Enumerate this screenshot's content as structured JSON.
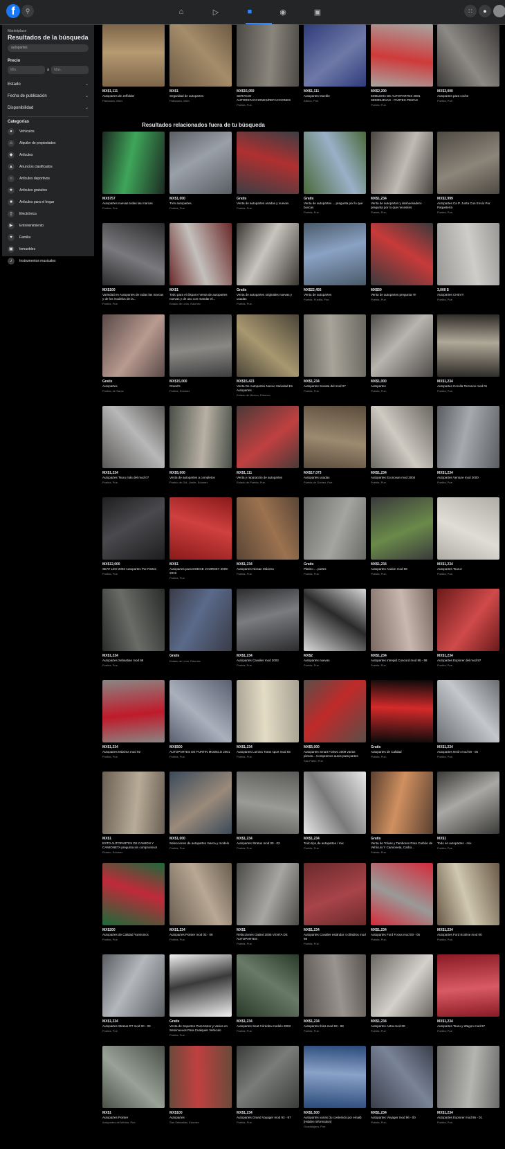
{
  "sidebar": {
    "breadcrumb": "Marketplace",
    "title": "Resultados de la búsqueda",
    "search_value": "autopartes",
    "price_label": "Precio",
    "min_placeholder": "Mín.",
    "max_placeholder": "Máx.",
    "price_separator": "a",
    "filters": [
      "Estado",
      "Fecha de publicación",
      "Disponibilidad"
    ],
    "categories_label": "Categorías",
    "categories": [
      {
        "label": "Vehículos",
        "icon": "car-icon"
      },
      {
        "label": "Alquiler de propiedades",
        "icon": "house-icon"
      },
      {
        "label": "Artículos",
        "icon": "tag-icon"
      },
      {
        "label": "Anuncios clasificados",
        "icon": "megaphone-icon"
      },
      {
        "label": "Artículos deportivos",
        "icon": "sports-icon"
      },
      {
        "label": "Artículos gratuitos",
        "icon": "free-icon"
      },
      {
        "label": "Artículos para el hogar",
        "icon": "sofa-icon"
      },
      {
        "label": "Electrónica",
        "icon": "phone-icon"
      },
      {
        "label": "Entretenimiento",
        "icon": "film-icon"
      },
      {
        "label": "Familia",
        "icon": "heart-icon"
      },
      {
        "label": "Inmuebles",
        "icon": "building-icon"
      },
      {
        "label": "Instrumentos musicales",
        "icon": "guitar-icon"
      }
    ]
  },
  "related_heading": "Resultados relacionados fuera de tu búsqueda",
  "listings": [
    {
      "price": "MX$1,111",
      "title": "Autopartes de Jeffolder",
      "loc": "Pátzcuaro, Mich."
    },
    {
      "price": "MX$1",
      "title": "Seguridad de autopartes",
      "loc": "Pátzcuaro, Mich."
    },
    {
      "price": "MX$15,059",
      "title": "SERVICIO AUTOREFACCIONES/REFACCIONES PARA TODO TIPO PIEZAS DE COLISION",
      "loc": "Puebla, Pue."
    },
    {
      "price": "MX$1,111",
      "title": "Autopartes Mueble",
      "loc": "Atlixco, Pue."
    },
    {
      "price": "MX$2,200",
      "title": "EMBLEMA DE AUTOPARTES 2001 SEMINUEVAS - PARTES PIEZAS DEPORTIVAS...",
      "loc": "Puebla, Pue."
    },
    {
      "price": "MX$3,000",
      "title": "Autopartes para coche",
      "loc": "Puebla, Pue."
    },
    {
      "price": "MX$757",
      "title": "Autopartes nuevas todas las marcas",
      "loc": "Puebla, Pue."
    },
    {
      "price": "MX$1,000",
      "title": "Tren autopartes",
      "loc": "Puebla, Pue."
    },
    {
      "price": "Gratis",
      "title": "Venta de autopartes usadas y nuevas",
      "loc": "Puebla, Pue."
    },
    {
      "price": "Gratis",
      "title": "Venta de autopartes ... pregunta por lo que buscas",
      "loc": "Puebla, Pue."
    },
    {
      "price": "MX$1,234",
      "title": "Venta de autopartes y deshuesadero pregunta por lo que necesites",
      "loc": "Puebla, Pue."
    },
    {
      "price": "MX$2,999",
      "title": "Autopartes Ca P. Junta Con Envío Por Paquetería",
      "loc": "Puebla, Pue."
    },
    {
      "price": "MX$100",
      "title": "Variedad en Autopartes de todas las marcas y de los modelos de la...",
      "loc": "Puebla, Pue."
    },
    {
      "price": "MX$1",
      "title": "Todo para el disparo! Venta de autopartes nuevas y de uso con mandar el...",
      "loc": "Estado de León, Edomex"
    },
    {
      "price": "Gratis",
      "title": "Venta de autopartes originales nuevas y usadas",
      "loc": "Puebla, Pue."
    },
    {
      "price": "MX$22,456",
      "title": "Venta de autopartes",
      "loc": "Puebla, Puebla, Pue."
    },
    {
      "price": "MX$50",
      "title": "Venta de autopartes pregunta !!!!",
      "loc": "Puebla, Pue."
    },
    {
      "price": "3,000 $",
      "title": "Autopartes CHEVY",
      "loc": "Puebla, Pue."
    },
    {
      "price": "Gratis",
      "title": "Autopartes",
      "loc": "Puebla, de Saraz"
    },
    {
      "price": "MX$15,000",
      "title": "Grand's",
      "loc": "Puebla, Edomex"
    },
    {
      "price": "MX$15,423",
      "title": "Venta De Autopartes Nuevo Variedad En Autopartes",
      "loc": "Estado de México, Edomex"
    },
    {
      "price": "MX$1,234",
      "title": "Autopartes Sonata del mod 07",
      "loc": "Puebla, Pue."
    },
    {
      "price": "MX$1,000",
      "title": "Autopartes",
      "loc": "Puebla, Pue."
    },
    {
      "price": "MX$1,234",
      "title": "Autopartes Corolla Terranos mod 01",
      "loc": "Puebla, Pue."
    },
    {
      "price": "MX$1,234",
      "title": "Autopartes Tsuru más del mod 07",
      "loc": "Puebla, Pue."
    },
    {
      "price": "MX$5,000",
      "title": "Venta de autopartes a completos",
      "loc": "Pueblo de Gdl. Límite, Edomex"
    },
    {
      "price": "MX$1,111",
      "title": "Venta y reparación de autopartes",
      "loc": "Estado de Puebla, Pue."
    },
    {
      "price": "MX$17,073",
      "title": "Autopartes usadas",
      "loc": "Puebla de Gómez, Pue."
    },
    {
      "price": "MX$1,234",
      "title": "Autopartes Econovan mod 2004",
      "loc": "Puebla, Pue."
    },
    {
      "price": "MX$1,234",
      "title": "Autopartes Venture mod 2000",
      "loc": "Puebla, Pue."
    },
    {
      "price": "MX$12,000",
      "title": "SEAT LEO 2003 Autopartes Por Partes",
      "loc": "Puebla, Pue."
    },
    {
      "price": "MX$1",
      "title": "Autopartes para DODGE JOURNEY 2009-2019",
      "loc": "Puebla, Pue."
    },
    {
      "price": "MX$1,234",
      "title": "Autopartes Nissan Máxima",
      "loc": "Puebla, Pue."
    },
    {
      "price": "Gratis",
      "title": "Platino ... partes",
      "loc": "Puebla, Pue."
    },
    {
      "price": "MX$1,234",
      "title": "Autopartes Avalon mod 98",
      "loc": "Puebla, Pue."
    },
    {
      "price": "MX$1,234",
      "title": "Autopartes Tsuru I",
      "loc": "Puebla, Pue."
    },
    {
      "price": "MX$1,234",
      "title": "Autopartes Sebastian mod 98",
      "loc": "Puebla, Pue."
    },
    {
      "price": "Gratis",
      "title": "",
      "loc": "Estado de León, Edomex"
    },
    {
      "price": "MX$1,234",
      "title": "Autopartes Cavalier mod 2003",
      "loc": "Puebla, Pue."
    },
    {
      "price": "MX$2",
      "title": "Autopartes nuevas",
      "loc": "Puebla, Pue."
    },
    {
      "price": "MX$1,234",
      "title": "Autopartes Intrepid Concord mod 95 - 98",
      "loc": "Puebla, Pue."
    },
    {
      "price": "MX$1,234",
      "title": "Autopartes Explorer del mod 97",
      "loc": "Puebla, Pue."
    },
    {
      "price": "MX$1,234",
      "title": "Autopartes Máxima mod 92",
      "loc": "Puebla, Pue."
    },
    {
      "price": "MX$500",
      "title": "AUTOPARTES DE PURTIN MODELO 2001",
      "loc": "Puebla, Pue."
    },
    {
      "price": "MX$1,234",
      "title": "Autopartes Lumina Trans sport mod 93",
      "loc": "Puebla, Pue."
    },
    {
      "price": "MX$5,000",
      "title": "Autopartes Smart Fortwo 2009 varias piezas... Compramos autos para partes",
      "loc": "San Pablo, Pue."
    },
    {
      "price": "Gratis",
      "title": "Autopartes de Calidad",
      "loc": "Puebla, Pue."
    },
    {
      "price": "MX$1,234",
      "title": "Autopartes Neón mod 00 - 05",
      "loc": "Puebla, Pue."
    },
    {
      "price": "MX$1",
      "title": "ESTO AUTOPARTES DE CAMION Y CAMIONETA pregunta sin compromiso!",
      "loc": "Estado, Edomex"
    },
    {
      "price": "MX$1,000",
      "title": "Selecciones de autopartes marca y modelo",
      "loc": "Puebla, Pue."
    },
    {
      "price": "MX$1,234",
      "title": "Autopartes Stratus mod 00 - 03",
      "loc": "Puebla, Pue."
    },
    {
      "price": "MX$1,234",
      "title": "Todo tipo de autopartes / mix",
      "loc": "Puebla, Pue."
    },
    {
      "price": "Gratis",
      "title": "Venta de Tolvas y Tambores Para Carbón de Vehículo Y Camioneta, Carbo...",
      "loc": "Puebla, Pue."
    },
    {
      "price": "MX$1",
      "title": "Todo en autopartes - mix",
      "loc": "Puebla, Pue."
    },
    {
      "price": "MX$200",
      "title": "Autopartes de Calidad Yuntronics",
      "loc": "Puebla, Pue."
    },
    {
      "price": "MX$1,234",
      "title": "Autopartes Pointer mod 03 - 09",
      "loc": "Puebla, Pue."
    },
    {
      "price": "MX$1",
      "title": "Refacciones Galant 2005 VENTA DE AUTOPARTES",
      "loc": "Puebla, Pue."
    },
    {
      "price": "MX$1,234",
      "title": "Autopartes Cavalier estándar 4 cilindros mod 98",
      "loc": "Puebla, Pue."
    },
    {
      "price": "MX$1,234",
      "title": "Autopartes Ford Focus mod 00 - 05",
      "loc": "Puebla, Pue."
    },
    {
      "price": "MX$1,234",
      "title": "Autopartes Ford Ecoline mod 00",
      "loc": "Puebla, Pue."
    },
    {
      "price": "MX$1,234",
      "title": "Autopartes Stratus RT mod 00 - 03",
      "loc": "Puebla, Pue."
    },
    {
      "price": "Gratis",
      "title": "Venta de Soportes Para Motor y Varios en Seminuevos Para Cualquier Vehículo",
      "loc": "Puebla, Pue."
    },
    {
      "price": "MX$1,234",
      "title": "Autopartes Seat Córdoba modelo 2003",
      "loc": "Puebla, Pue."
    },
    {
      "price": "MX$1,234",
      "title": "Autopartes Ibiza mod 93 - 98",
      "loc": "Puebla, Pue."
    },
    {
      "price": "MX$1,234",
      "title": "Autopartes Astra mod 00",
      "loc": "Puebla, Pue."
    },
    {
      "price": "MX$1,234",
      "title": "Autopartes Tsuru y Wagon mod 97",
      "loc": "Puebla, Pue."
    },
    {
      "price": "MX$1",
      "title": "Autopartes Pointer",
      "loc": "Autopartes de Mérida, Pue."
    },
    {
      "price": "MX$100",
      "title": "Autopartes",
      "loc": "San Sebastián, Edomex"
    },
    {
      "price": "MX$1,234",
      "title": "Autopartes Grand Voyager mod 93 - 97",
      "loc": "Puebla, Pue."
    },
    {
      "price": "MX$1,500",
      "title": "Autopartes varias (tu contenido por email) [Hidden information]",
      "loc": "Guadalajara, Pue."
    },
    {
      "price": "MX$1,234",
      "title": "Autopartes Voyager mod 96 - 00",
      "loc": "Puebla, Pue."
    },
    {
      "price": "MX$1,234",
      "title": "Autopartes Explorer mod 95 - 01",
      "loc": "Puebla, Pue."
    }
  ],
  "thumb_colors": [
    [
      "#7d6548",
      "#b59a72"
    ],
    [
      "#6e5a44",
      "#a58d6a"
    ],
    [
      "#4c4a46",
      "#8a857c"
    ],
    [
      "#2e3c7a",
      "#6f79a8"
    ],
    [
      "#a8a4a0",
      "#cf3a3a"
    ],
    [
      "#3b3936",
      "#8d8a86"
    ],
    [
      "#1c2b22",
      "#3fa65a"
    ],
    [
      "#5a5f66",
      "#9aa0a8"
    ],
    [
      "#3c3e44",
      "#b03030"
    ],
    [
      "#4a6a3a",
      "#9ab0c8"
    ],
    [
      "#4a4440",
      "#c0bbb4"
    ],
    [
      "#4e4a42",
      "#8c857a"
    ],
    [
      "#2a2a2c",
      "#7a7a7e"
    ],
    [
      "#6a2a2a",
      "#c4c0bc"
    ],
    [
      "#3a3632",
      "#c8c4be"
    ],
    [
      "#4a5a6a",
      "#8aa2c4"
    ],
    [
      "#3a3a3c",
      "#c83a3a"
    ],
    [
      "#9a9896",
      "#cfcdca"
    ],
    [
      "#5a4a48",
      "#b89a90"
    ],
    [
      "#3e3e40",
      "#8a8884"
    ],
    [
      "#4a4438",
      "#a89870"
    ],
    [
      "#6a6860",
      "#a8a49a"
    ],
    [
      "#4e4c4a",
      "#b8b4ae"
    ],
    [
      "#2c2a26",
      "#b0a898"
    ],
    [
      "#5a5856",
      "#b8b8b8"
    ],
    [
      "#4a5048",
      "#b8b0a4"
    ],
    [
      "#4a3a38",
      "#c04040"
    ],
    [
      "#5a4c3c",
      "#9c8a70"
    ],
    [
      "#6a6862",
      "#cfcac2"
    ],
    [
      "#5a5e62",
      "#a6aaae"
    ],
    [
      "#1e1e20",
      "#4a4a4e"
    ],
    [
      "#8a1a1a",
      "#d04040"
    ],
    [
      "#5a4636",
      "#9c7250"
    ],
    [
      "#6a6a68",
      "#a4a4a0"
    ],
    [
      "#3a3a3c",
      "#6a8a4a"
    ],
    [
      "#b0aca6",
      "#e0dcd6"
    ],
    [
      "#2a2c2a",
      "#6a6c68"
    ],
    [
      "#3a3c48",
      "#5a6a8a"
    ],
    [
      "#2c2c2e",
      "#7a7c80"
    ],
    [
      "#d8d8d8",
      "#2a2a2a"
    ],
    [
      "#7a6a62",
      "#c8b8b0"
    ],
    [
      "#6a1a1a",
      "#d04a4a"
    ],
    [
      "#8a8684",
      "#c01a2a"
    ],
    [
      "#5a6070",
      "#aab0bc"
    ],
    [
      "#a8a294",
      "#e4dcc4"
    ],
    [
      "#5a4e48",
      "#c02a2a"
    ],
    [
      "#0a0a0a",
      "#d42a2a"
    ],
    [
      "#6a6e72",
      "#c4c8cc"
    ],
    [
      "#6a6054",
      "#b8ac98"
    ],
    [
      "#3a4a5a",
      "#9a8a7a"
    ],
    [
      "#5a5a58",
      "#9a9a96"
    ],
    [
      "#e8e8e8",
      "#7a7a7a"
    ],
    [
      "#5a4030",
      "#d09060"
    ],
    [
      "#3a3a38",
      "#aaa8a4"
    ],
    [
      "#1a6a3a",
      "#c02a3a"
    ],
    [
      "#6a5e50",
      "#b8a894"
    ],
    [
      "#4a4a48",
      "#a8a6a2"
    ],
    [
      "#6a2a2a",
      "#a8444a"
    ],
    [
      "#d42a3a",
      "#9a9a98"
    ],
    [
      "#6a5a48",
      "#d0c8b0"
    ],
    [
      "#5a5e62",
      "#b4b8bc"
    ],
    [
      "#f0f0f0",
      "#3a3a3a"
    ],
    [
      "#2a3a2a",
      "#6a7a68"
    ],
    [
      "#5a5450",
      "#9a9490"
    ],
    [
      "#6a6662",
      "#d4d0cc"
    ],
    [
      "#8a1a24",
      "#d85a64"
    ],
    [
      "#4a5048",
      "#9aa298"
    ],
    [
      "#6a4a3a",
      "#c04040"
    ],
    [
      "#3a3c3a",
      "#7a7c7a"
    ],
    [
      "#2a4a7a",
      "#8aa2c8"
    ],
    [
      "#3a3e4a",
      "#7a8498"
    ],
    [
      "#6a6a6a",
      "#b4b4b0"
    ]
  ]
}
